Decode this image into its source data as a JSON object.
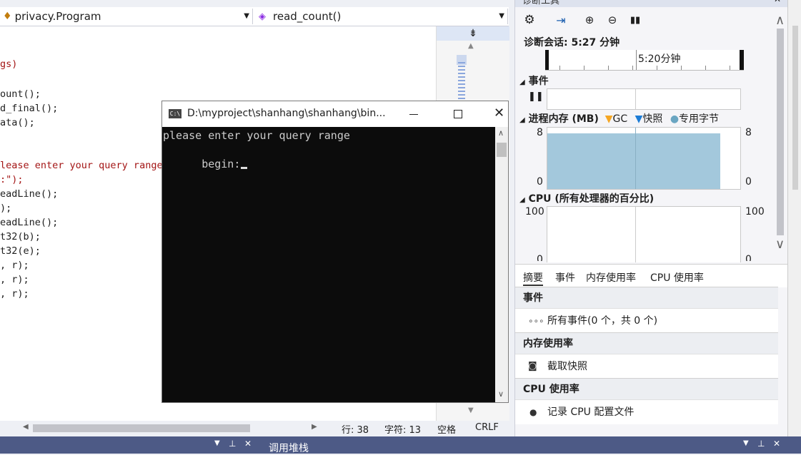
{
  "editor": {
    "nav_class": "privacy.Program",
    "nav_member": "read_count()",
    "code_lines": [
      {
        "text": "gs)",
        "kind": "str"
      },
      {
        "text": "ount();",
        "kind": "code"
      },
      {
        "text": "d_final();",
        "kind": "code"
      },
      {
        "text": "ata();",
        "kind": "code"
      },
      {
        "text": "lease enter your query range",
        "kind": "str"
      },
      {
        "text": ":\");",
        "kind": "str"
      },
      {
        "text": "eadLine();",
        "kind": "code"
      },
      {
        "text": ");",
        "kind": "code"
      },
      {
        "text": "eadLine();",
        "kind": "code"
      },
      {
        "text": "t32(b);",
        "kind": "code"
      },
      {
        "text": "t32(e);",
        "kind": "code"
      },
      {
        "text": ", r);",
        "kind": "code"
      },
      {
        "text": ", r);",
        "kind": "code"
      },
      {
        "text": ", r);",
        "kind": "code"
      }
    ],
    "status": {
      "line": "行: 38",
      "char": "字符: 13",
      "space": "空格",
      "eol": "CRLF"
    }
  },
  "console": {
    "title": "D:\\myproject\\shanhang\\shanhang\\bin...",
    "line1": "please enter your query range",
    "line2": "begin:"
  },
  "diag": {
    "title": "诊断工具",
    "session": "诊断会话: 5:27 分钟",
    "timeline_label": "5:20分钟",
    "events_label": "事件",
    "memory_label": "进程内存 (MB)",
    "gc_label": "GC",
    "snapshot_label": "快照",
    "private_bytes_label": "专用字节",
    "mem_max": "8",
    "mem_min": "0",
    "cpu_label": "CPU (所有处理器的百分比)",
    "cpu_max": "100",
    "cpu_min": "0",
    "tabs": [
      "摘要",
      "事件",
      "内存使用率",
      "CPU 使用率"
    ],
    "list": {
      "events_header": "事件",
      "events_item": "所有事件(0 个，共 0 个)",
      "memory_header": "内存使用率",
      "memory_item": "截取快照",
      "cpu_header": "CPU 使用率",
      "cpu_item": "记录 CPU 配置文件"
    }
  },
  "bottom": {
    "call_stack": "调用堆栈"
  },
  "colors": {
    "memory_fill": "#a3c8dc",
    "gc_marker": "#f5a623",
    "snapshot_marker": "#1c7cd6",
    "private_bytes_marker": "#6aa6c2"
  }
}
